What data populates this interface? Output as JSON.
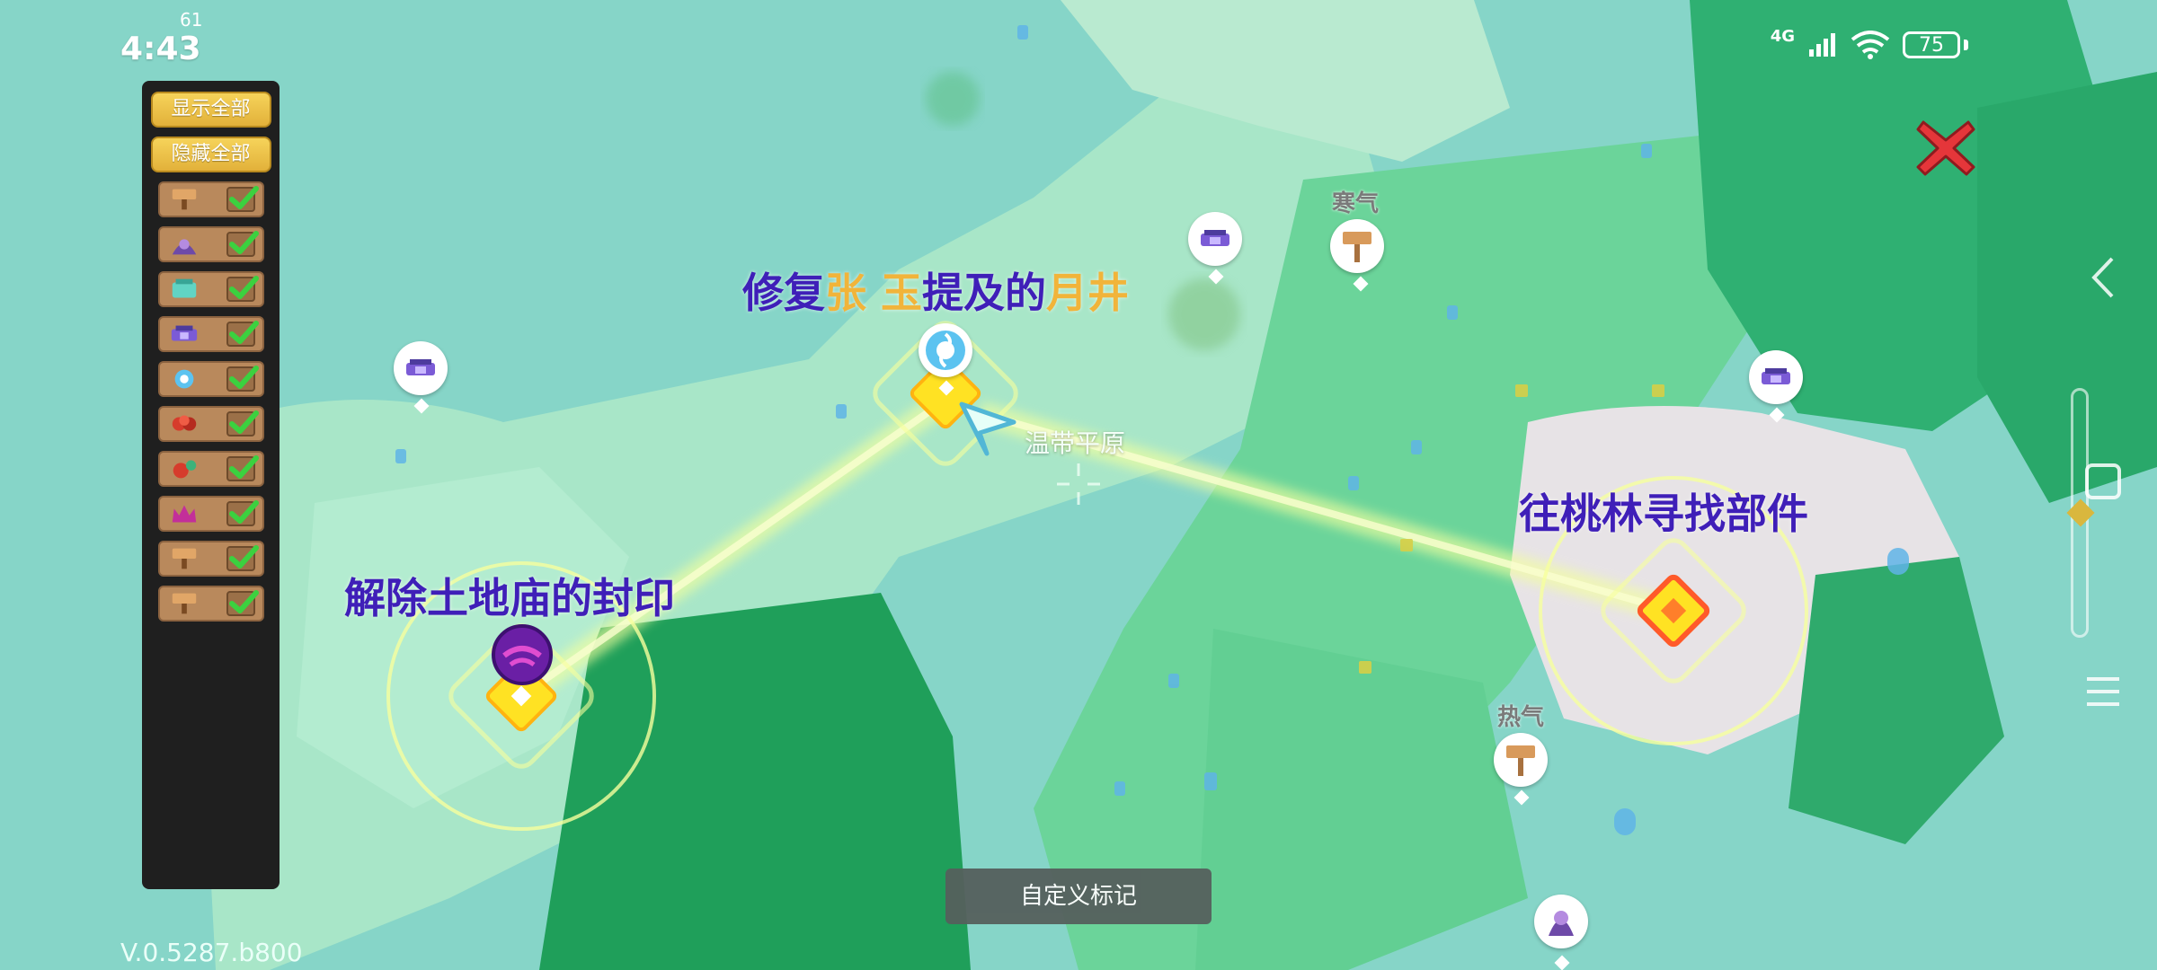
{
  "status_bar": {
    "time": "4:43",
    "small_badge": "61",
    "network": "4G",
    "battery": "75"
  },
  "filter_panel": {
    "show_all_label": "显示全部",
    "hide_all_label": "隐藏全部",
    "items": [
      {
        "icon": "signpost-icon",
        "checked": true
      },
      {
        "icon": "hooded-figure-icon",
        "checked": true
      },
      {
        "icon": "teal-shrine-icon",
        "checked": true
      },
      {
        "icon": "purple-gate-icon",
        "checked": true
      },
      {
        "icon": "swirl-orb-icon",
        "checked": true
      },
      {
        "icon": "red-monster-icon",
        "checked": true
      },
      {
        "icon": "red-flower-monster-icon",
        "checked": true
      },
      {
        "icon": "magenta-crown-icon",
        "checked": true
      },
      {
        "icon": "signpost-icon",
        "checked": true
      },
      {
        "icon": "signpost-icon",
        "checked": true
      }
    ]
  },
  "quests": {
    "q1": {
      "parts": [
        "修复",
        "张",
        " ",
        "玉",
        "提及的",
        "月井"
      ]
    },
    "q2": "解除土地庙的封印",
    "q3": "往桃林寻找部件"
  },
  "map_labels": {
    "region": "温带平原",
    "cold": "寒气",
    "heat": "热气"
  },
  "custom_mark_label": "自定义标记",
  "version": "V.0.5287.b800",
  "colors": {
    "quest_text": "#3f1fb8",
    "quest_highlight": "#f1b43a",
    "route": "#e9ff9c",
    "panel_bg": "#1f1f1f",
    "button_yellow": "#f0c64d"
  }
}
